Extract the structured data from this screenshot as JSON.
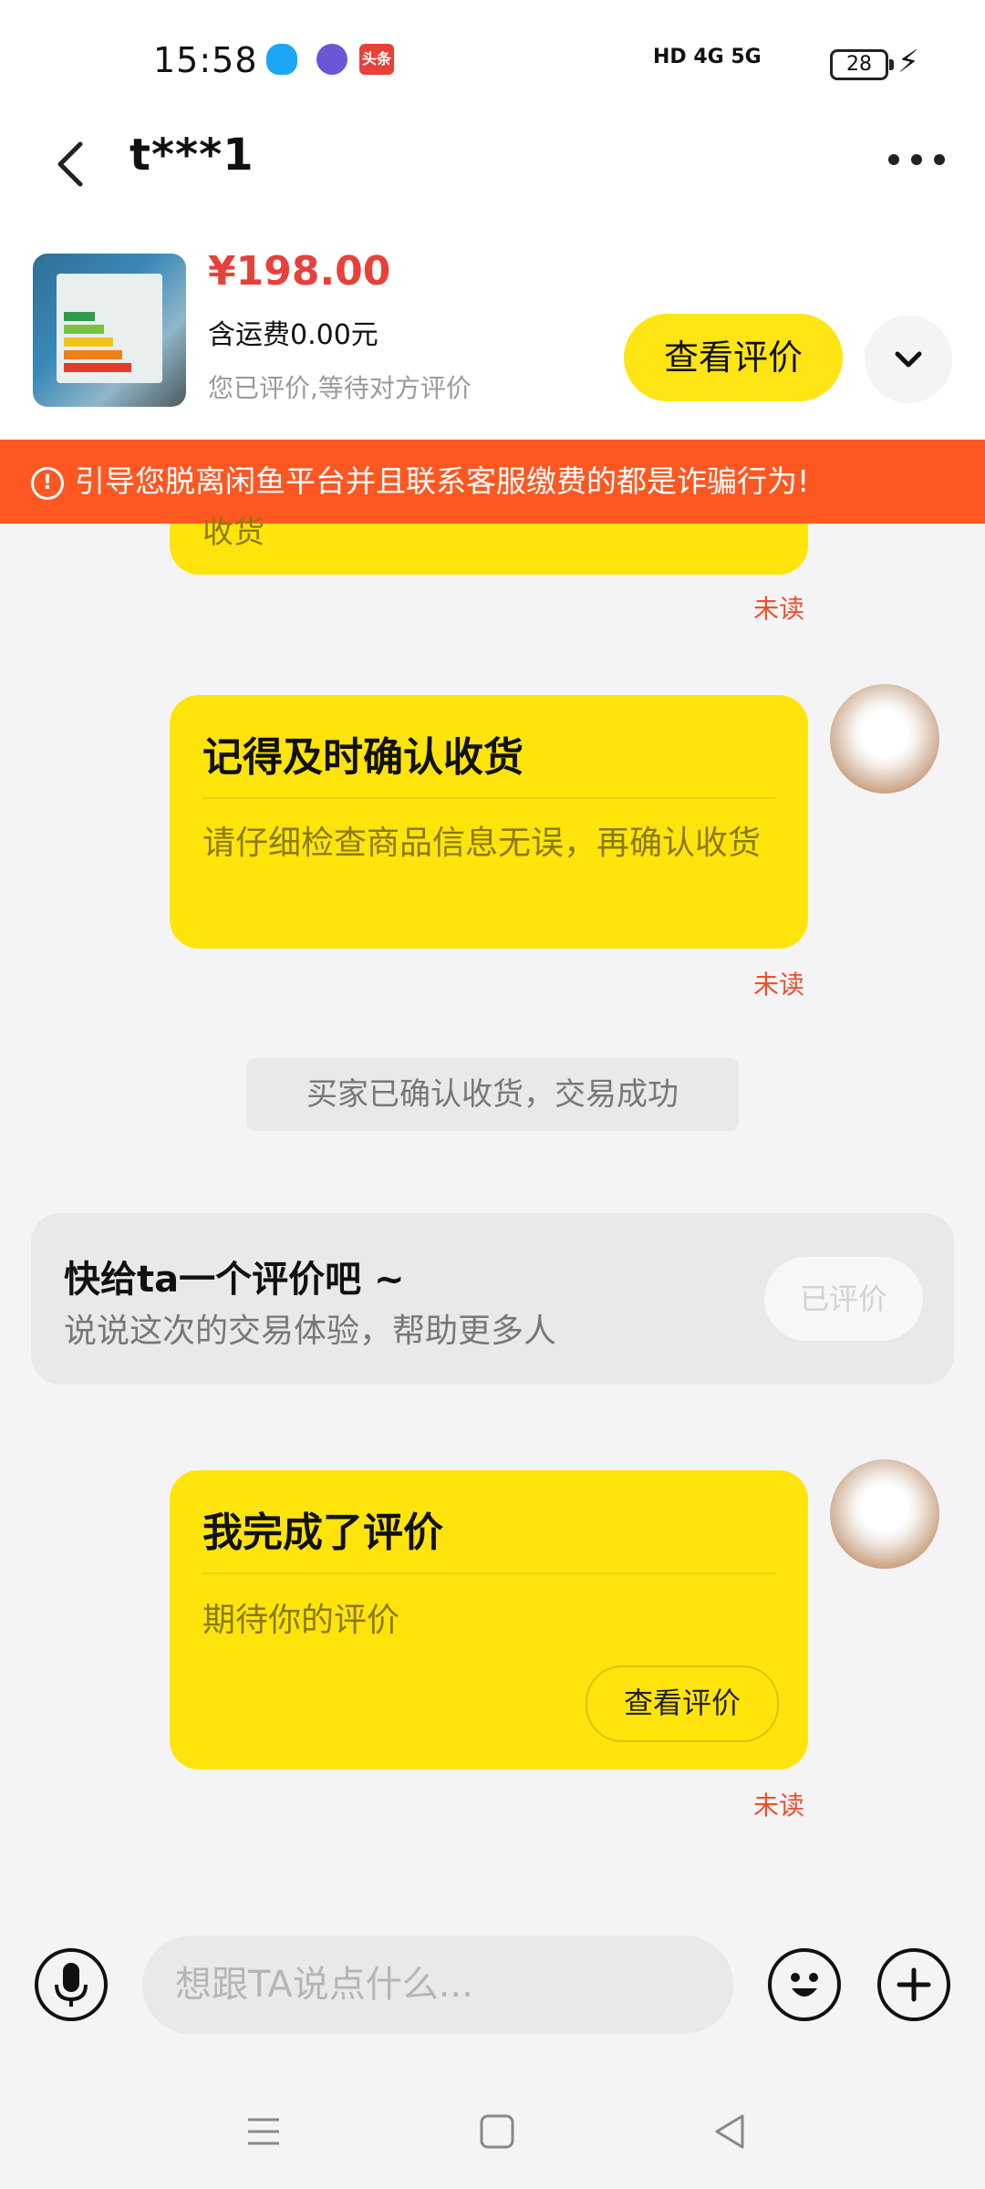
{
  "status_bar": {
    "time": "15:58",
    "network_labels": "HD 4G 5G",
    "battery": "28"
  },
  "header": {
    "title": "t***1"
  },
  "product": {
    "price": "¥198.00",
    "shipping": "含运费0.00元",
    "review_status": "您已评价,等待对方评价",
    "view_review_label": "查看评价"
  },
  "warning": {
    "text": "引导您脱离闲鱼平台并且联系客服缴费的都是诈骗行为!"
  },
  "chat": {
    "top_bubble_tail": "收货",
    "unread_label": "未读",
    "reminder": {
      "title": "记得及时确认收货",
      "body": "请仔细检查商品信息无误，再确认收货"
    },
    "system_message": "买家已确认收货，交易成功",
    "review_prompt": {
      "title": "快给ta一个评价吧 ~",
      "subtitle": "说说这次的交易体验，帮助更多人",
      "button": "已评价"
    },
    "completed": {
      "title": "我完成了评价",
      "body": "期待你的评价",
      "button": "查看评价"
    }
  },
  "input_bar": {
    "placeholder": "想跟TA说点什么..."
  },
  "colors": {
    "accent_yellow": "#ffe40b",
    "price_red": "#e8403a",
    "warning_orange": "#ff5722",
    "unread_red": "#f04f2a"
  }
}
